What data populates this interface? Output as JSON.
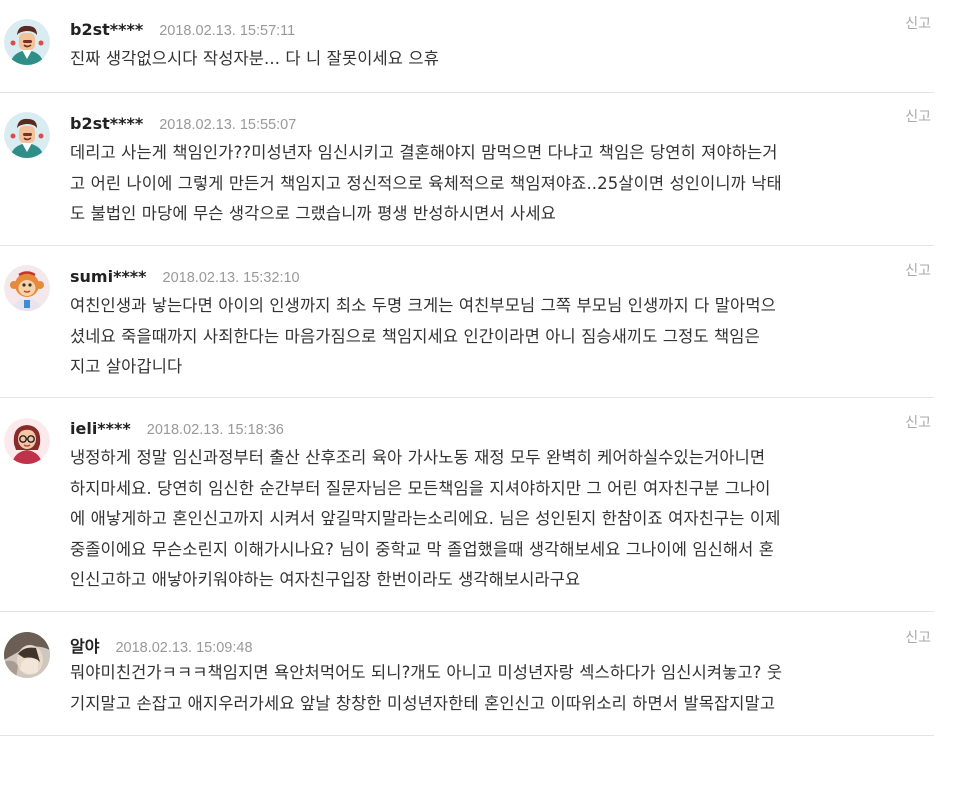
{
  "comments": [
    {
      "nickname": "b2st****",
      "datetime": "2018.02.13. 15:57:11",
      "report": "신고",
      "avatar_icon": "doctor-avatar-icon",
      "lines": [
        "진짜 생각없으시다 작성자분... 다 니 잘못이세요 으휴"
      ]
    },
    {
      "nickname": "b2st****",
      "datetime": "2018.02.13. 15:55:07",
      "report": "신고",
      "avatar_icon": "doctor-avatar-icon",
      "lines": [
        "데리고 사는게 책임인가??미성년자 임신시키고 결혼해야지 맘먹으면 다냐고 책임은 당연히 져야하는거",
        "고 어린 나이에 그렇게 만든거 책임지고 정신적으로 육체적으로 책임져야죠..25살이면 성인이니까 낙태",
        "도 불법인 마당에 무슨 생각으로 그랬습니까 평생 반성하시면서 사세요"
      ]
    },
    {
      "nickname": "sumi****",
      "datetime": "2018.02.13. 15:32:10",
      "report": "신고",
      "avatar_icon": "monkey-avatar-icon",
      "lines": [
        "여친인생과 낳는다면 아이의 인생까지 최소 두명 크게는 여친부모님 그쪽 부모님 인생까지 다 말아먹으",
        "셨네요 죽을때까지 사죄한다는 마음가짐으로 책임지세요 인간이라면 아니 짐승새끼도 그정도 책임은",
        "지고 살아갑니다"
      ]
    },
    {
      "nickname": "ieli****",
      "datetime": "2018.02.13. 15:18:36",
      "report": "신고",
      "avatar_icon": "glasses-woman-avatar-icon",
      "lines": [
        "냉정하게 정말 임신과정부터 출산 산후조리 육아 가사노동 재정 모두 완벽히 케어하실수있는거아니면",
        "하지마세요. 당연히 임신한 순간부터 질문자님은 모든책임을 지셔야하지만 그 어린 여자친구분 그나이",
        "에 애낳게하고 혼인신고까지 시켜서 앞길막지말라는소리에요. 님은 성인된지 한참이죠 여자친구는 이제",
        "중졸이에요 무슨소린지 이해가시나요? 님이 중학교 막 졸업했을때 생각해보세요 그나이에 임신해서 혼",
        "인신고하고 애낳아키워야하는 여자친구입장 한번이라도 생각해보시라구요"
      ]
    },
    {
      "nickname": "알야",
      "datetime": "2018.02.13. 15:09:48",
      "report": "신고",
      "avatar_icon": "photo-avatar-icon",
      "lines": [
        "뭐야미친건가ㅋㅋㅋ책임지면 욕안처먹어도 되니?개도 아니고 미성년자랑 섹스하다가 임신시켜놓고? 웃",
        "기지말고 손잡고 애지우러가세요 앞날 창창한 미성년자한테 혼인신고 이따위소리 하면서 발목잡지말고"
      ]
    }
  ]
}
